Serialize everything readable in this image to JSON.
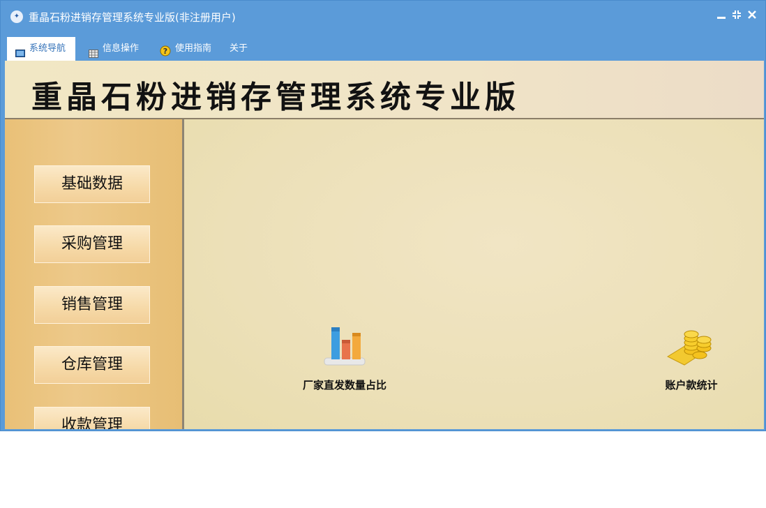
{
  "window": {
    "title": "重晶石粉进销存管理系统专业版(非注册用户)",
    "icon": "app-logo-icon",
    "controls": [
      "minimize-icon",
      "restore-icon",
      "close-icon"
    ]
  },
  "menu": {
    "items": [
      {
        "label": "系统导航",
        "icon": "monitor-icon"
      },
      {
        "label": "信息操作",
        "icon": "grid-icon"
      },
      {
        "label": "使用指南",
        "icon": "help-icon"
      },
      {
        "label": "关于"
      }
    ]
  },
  "banner": {
    "title": "重晶石粉进销存管理系统专业版"
  },
  "sidebar": {
    "items": [
      {
        "label": "基础数据"
      },
      {
        "label": "采购管理"
      },
      {
        "label": "销售管理"
      },
      {
        "label": "仓库管理"
      },
      {
        "label": "收款管理"
      }
    ]
  },
  "shortcuts": [
    {
      "label": "厂家直发数量占比",
      "icon": "bar-chart-icon"
    },
    {
      "label": "账户款统计",
      "icon": "coins-icon"
    }
  ],
  "colors": {
    "titlebar": "#5b9bd9",
    "banner": "#f1e7c4",
    "sidebar": "#e9c077",
    "main": "#ece0b8"
  }
}
